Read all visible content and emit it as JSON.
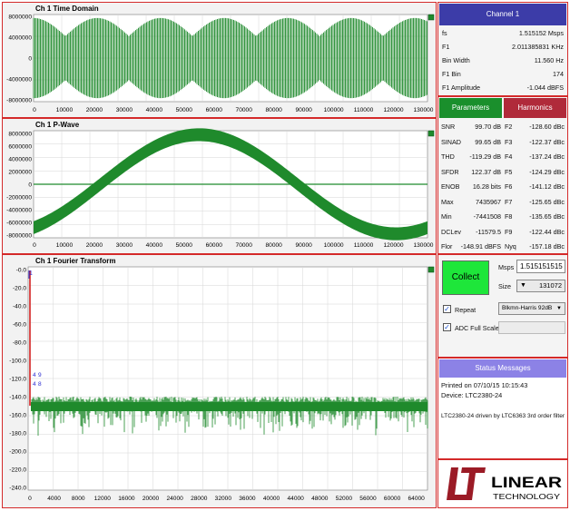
{
  "colors": {
    "accent_blue": "#3c3ca8",
    "harmonics_red": "#b02a3a",
    "params_green": "#1a8f2c",
    "signal_green": "#1f8a2c",
    "collect_green": "#1ee63a",
    "status_blue": "#8c82e6"
  },
  "time_domain": {
    "title": "Ch 1 Time Domain",
    "y_ticks": [
      "8000000",
      "4000000",
      "0",
      "-4000000",
      "-8000000"
    ],
    "x_ticks": [
      "0",
      "10000",
      "20000",
      "30000",
      "40000",
      "50000",
      "60000",
      "70000",
      "80000",
      "90000",
      "100000",
      "110000",
      "120000",
      "130000"
    ]
  },
  "pwave": {
    "title": "Ch 1 P-Wave",
    "y_ticks": [
      "8000000",
      "6000000",
      "4000000",
      "2000000",
      "0",
      "-2000000",
      "-4000000",
      "-6000000",
      "-8000000"
    ],
    "x_ticks": [
      "0",
      "10000",
      "20000",
      "30000",
      "40000",
      "50000",
      "60000",
      "70000",
      "80000",
      "90000",
      "100000",
      "110000",
      "120000",
      "130000"
    ]
  },
  "fft": {
    "title": "Ch 1 Fourier Transform",
    "y_ticks": [
      "-0.0",
      "-20.0",
      "-40.0",
      "-60.0",
      "-80.0",
      "-100.0",
      "-120.0",
      "-140.0",
      "-160.0",
      "-180.0",
      "-200.0",
      "-220.0",
      "-240.0"
    ],
    "x_ticks": [
      "0",
      "4000",
      "8000",
      "12000",
      "16000",
      "20000",
      "24000",
      "28000",
      "32000",
      "36000",
      "40000",
      "44000",
      "48000",
      "52000",
      "56000",
      "60000",
      "64000"
    ],
    "marker_label": "1",
    "harmonic_marks": [
      "4",
      "9",
      "4",
      "8"
    ]
  },
  "channel": {
    "header": "Channel 1",
    "rows": [
      {
        "label": "fs",
        "value": "1.515152 Msps"
      },
      {
        "label": "F1",
        "value": "2.011385831 KHz"
      },
      {
        "label": "Bin Width",
        "value": "11.560 Hz"
      },
      {
        "label": "F1 Bin",
        "value": "174"
      },
      {
        "label": "F1 Amplitude",
        "value": "-1.044 dBFS"
      }
    ]
  },
  "parameters": {
    "header": "Parameters",
    "rows": [
      {
        "label": "SNR",
        "value": "99.70 dB"
      },
      {
        "label": "SINAD",
        "value": "99.65 dB"
      },
      {
        "label": "THD",
        "value": "-119.29 dB"
      },
      {
        "label": "SFDR",
        "value": "122.37 dB"
      },
      {
        "label": "ENOB",
        "value": "16.28 bits"
      },
      {
        "label": "Max",
        "value": "7435967"
      },
      {
        "label": "Min",
        "value": "-7441508"
      },
      {
        "label": "DCLev",
        "value": "-11579.5"
      },
      {
        "label": "Flor",
        "value": "-148.91 dBFS"
      }
    ]
  },
  "harmonics": {
    "header": "Harmonics",
    "rows": [
      {
        "label": "F2",
        "value": "-128.60 dBc"
      },
      {
        "label": "F3",
        "value": "-122.37 dBc"
      },
      {
        "label": "F4",
        "value": "-137.24 dBc"
      },
      {
        "label": "F5",
        "value": "-124.29 dBc"
      },
      {
        "label": "F6",
        "value": "-141.12 dBc"
      },
      {
        "label": "F7",
        "value": "-125.65 dBc"
      },
      {
        "label": "F8",
        "value": "-135.65 dBc"
      },
      {
        "label": "F9",
        "value": "-122.44 dBc"
      },
      {
        "label": "Nyq",
        "value": "-157.18 dBc"
      }
    ]
  },
  "controls": {
    "collect_label": "Collect",
    "msps_label": "Msps",
    "msps_value": "1.515151515",
    "size_label": "Size",
    "size_value": "131072",
    "repeat_label": "Repeat",
    "repeat_checked": true,
    "window_value": "Blkmn-Harris 92dB",
    "adc_label": "ADC Full Scale",
    "adc_checked": true
  },
  "status": {
    "header": "Status Messages",
    "line1": "Printed on 07/10/15 10:15:43",
    "line2": "Device: LTC2380-24",
    "line3": "LTC2380-24 driven by LTC6363 3rd order filter"
  },
  "logo": {
    "name": "LINEAR",
    "sub": "TECHNOLOGY"
  }
}
